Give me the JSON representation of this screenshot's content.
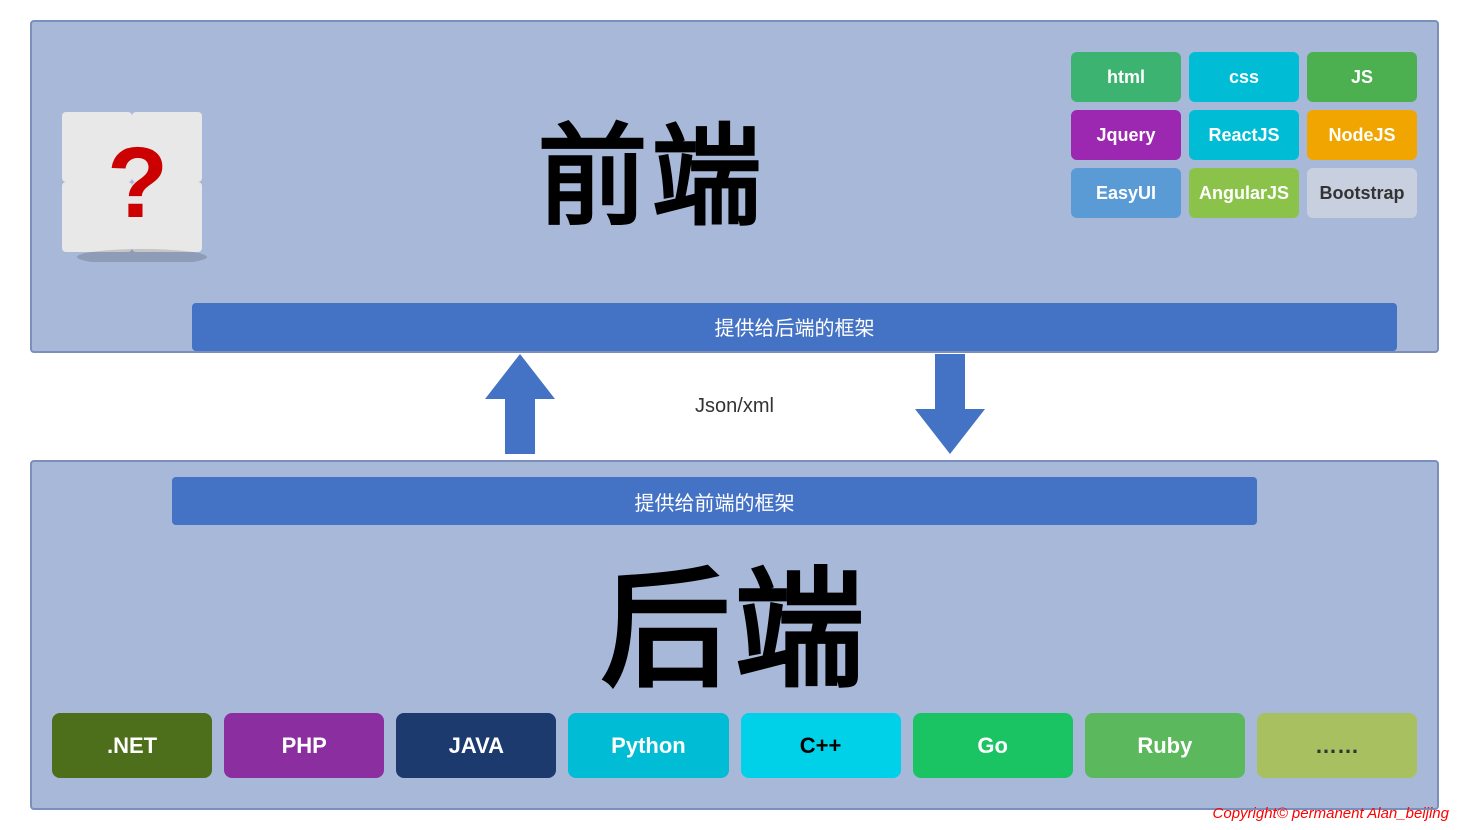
{
  "frontend": {
    "title": "前端",
    "framework_label": "提供给后端的框架",
    "badges": [
      {
        "id": "html",
        "label": "html",
        "class": "badge-html"
      },
      {
        "id": "css",
        "label": "css",
        "class": "badge-css"
      },
      {
        "id": "js",
        "label": "JS",
        "class": "badge-js"
      },
      {
        "id": "jquery",
        "label": "Jquery",
        "class": "badge-jquery"
      },
      {
        "id": "reactjs",
        "label": "ReactJS",
        "class": "badge-reactjs"
      },
      {
        "id": "nodejs",
        "label": "NodeJS",
        "class": "badge-nodejs"
      },
      {
        "id": "easyui",
        "label": "EasyUI",
        "class": "badge-easyui"
      },
      {
        "id": "angularjs",
        "label": "AngularJS",
        "class": "badge-angularjs"
      },
      {
        "id": "bootstrap",
        "label": "Bootstrap",
        "class": "badge-bootstrap"
      }
    ]
  },
  "middle": {
    "data_format": "Json/xml"
  },
  "backend": {
    "title": "后端",
    "framework_label": "提供给前端的框架",
    "badges": [
      {
        "id": "dotnet",
        "label": ".NET",
        "class": "bb-dotnet"
      },
      {
        "id": "php",
        "label": "PHP",
        "class": "bb-php"
      },
      {
        "id": "java",
        "label": "JAVA",
        "class": "bb-java"
      },
      {
        "id": "python",
        "label": "Python",
        "class": "bb-python"
      },
      {
        "id": "cpp",
        "label": "C++",
        "class": "bb-cpp"
      },
      {
        "id": "go",
        "label": "Go",
        "class": "bb-go"
      },
      {
        "id": "ruby",
        "label": "Ruby",
        "class": "bb-ruby"
      },
      {
        "id": "more",
        "label": "……",
        "class": "bb-more"
      }
    ]
  },
  "copyright": "Copyright© permanent  Alan_beijing"
}
